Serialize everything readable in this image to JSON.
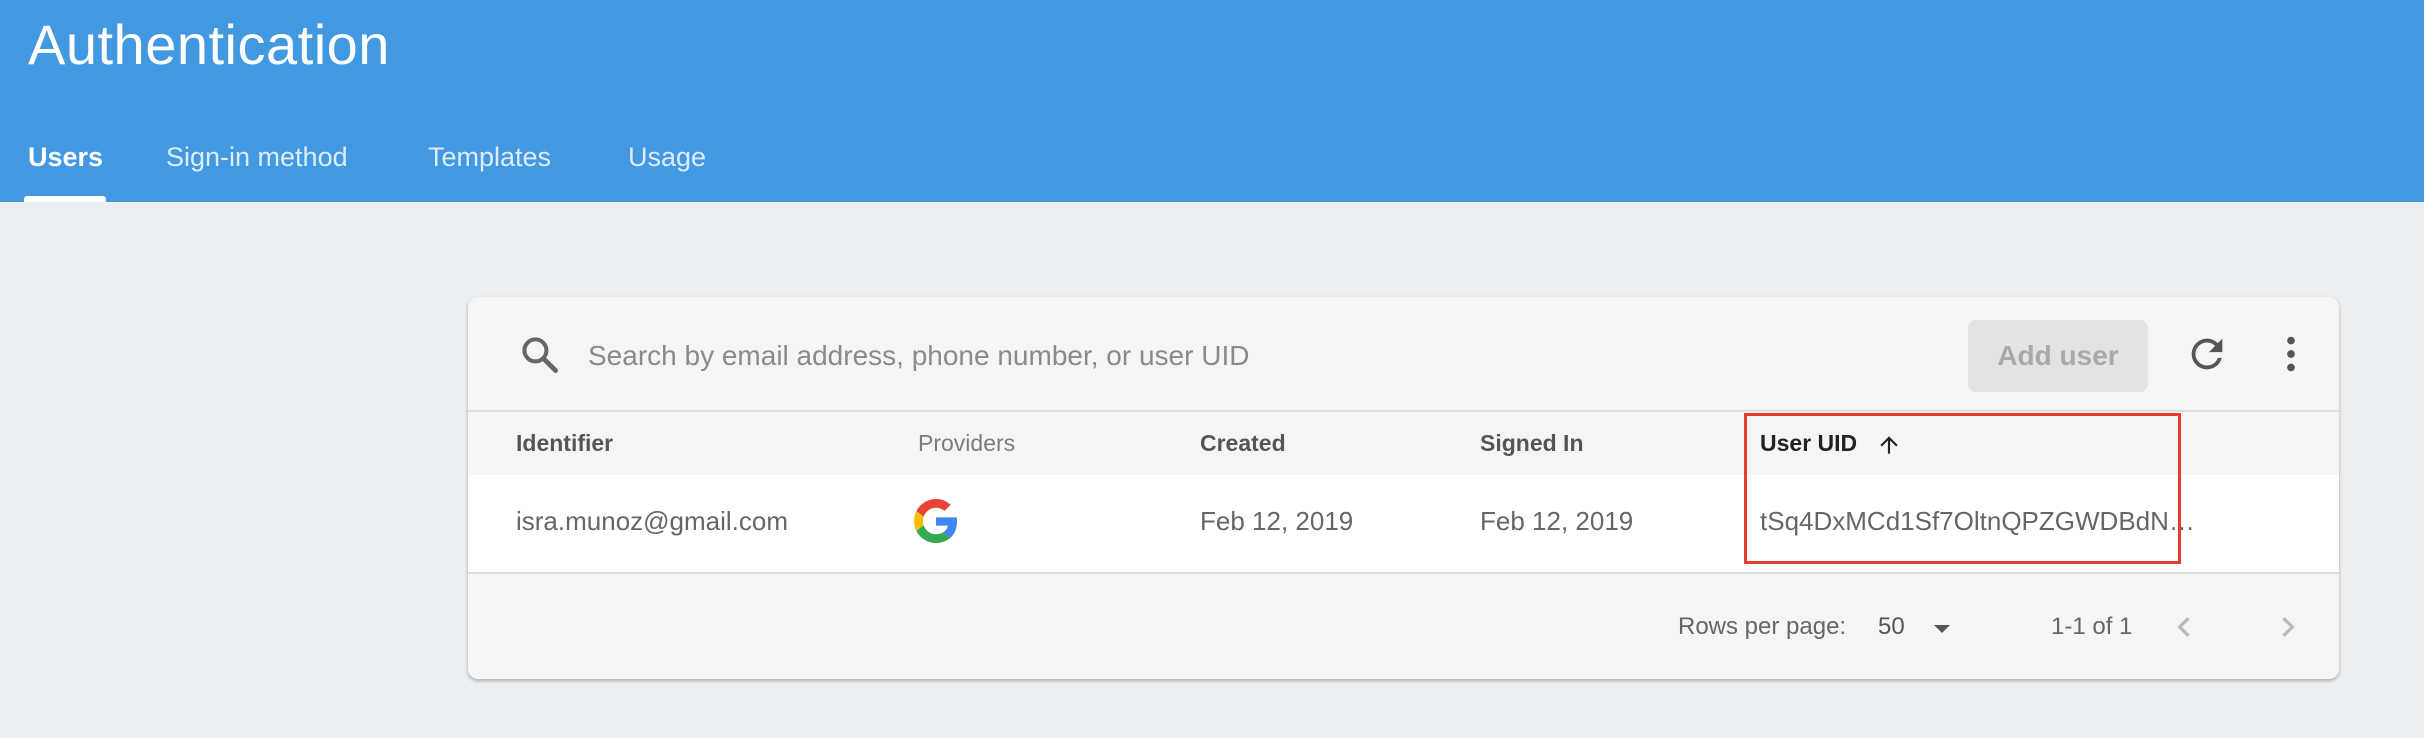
{
  "header": {
    "title": "Authentication",
    "tabs": [
      {
        "label": "Users",
        "active": true
      },
      {
        "label": "Sign-in method",
        "active": false
      },
      {
        "label": "Templates",
        "active": false
      },
      {
        "label": "Usage",
        "active": false
      }
    ]
  },
  "toolbar": {
    "search_icon": "search-icon",
    "search_placeholder": "Search by email address, phone number, or user UID",
    "search_value": "",
    "add_user_label": "Add user",
    "refresh_icon": "refresh-icon",
    "more_icon": "more-vert-icon"
  },
  "table": {
    "columns": [
      "Identifier",
      "Providers",
      "Created",
      "Signed In",
      "User UID"
    ],
    "sorted_column": "User UID",
    "sort_direction": "ascending",
    "rows": [
      {
        "identifier": "isra.munoz@gmail.com",
        "provider_icon": "google-icon",
        "created": "Feb 12, 2019",
        "signed_in": "Feb 12, 2019",
        "user_uid": "tSq4DxMCd1Sf7OltnQPZGWDBdN…"
      }
    ]
  },
  "pagination": {
    "rows_per_page_label": "Rows per page:",
    "rows_per_page_value": "50",
    "range": "1-1 of 1"
  },
  "colors": {
    "header": "#4399e1",
    "background": "#eceff1",
    "highlight": "#e53d2e"
  }
}
